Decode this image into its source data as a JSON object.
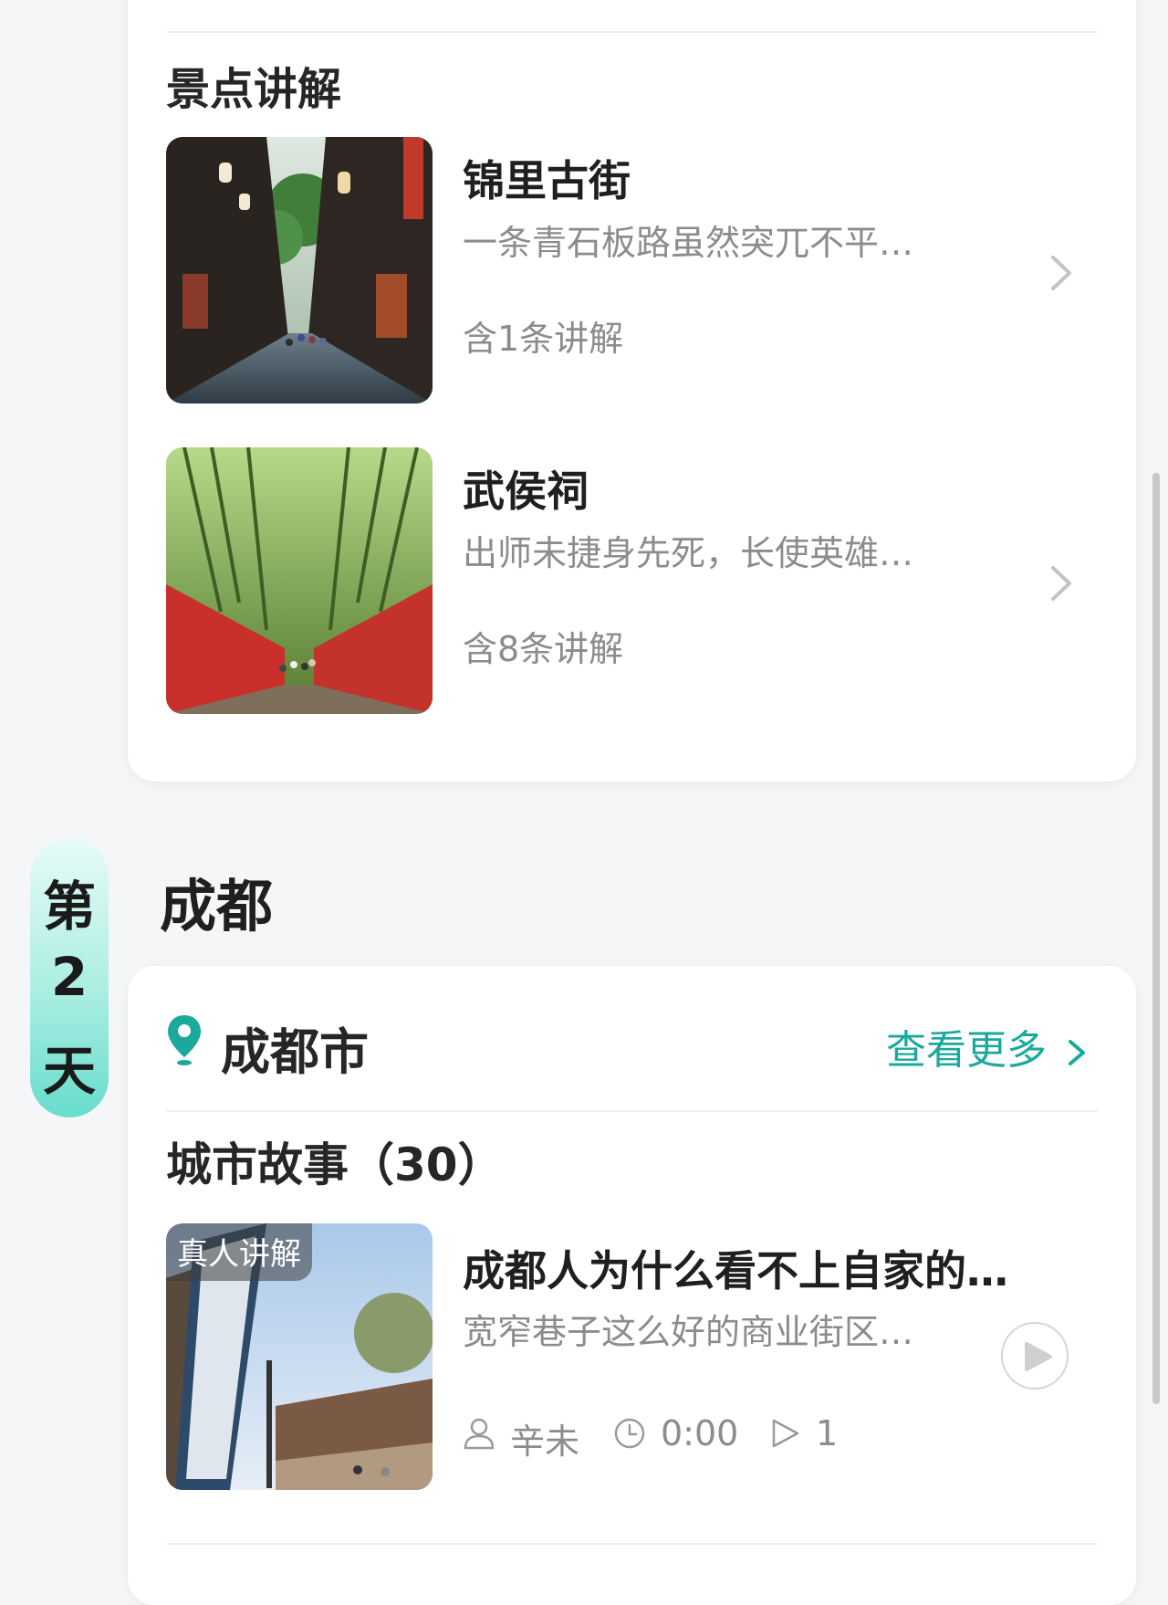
{
  "attractions_card": {
    "section_title": "景点讲解",
    "items": [
      {
        "name": "锦里古街",
        "desc": "一条青石板路虽然突兀不平…",
        "count": "含1条讲解"
      },
      {
        "name": "武侯祠",
        "desc": "出师未捷身先死，长使英雄…",
        "count": "含8条讲解"
      }
    ]
  },
  "day": {
    "chars": [
      "第",
      "2",
      "天"
    ],
    "city": "成都"
  },
  "city_card": {
    "city_name": "成都市",
    "more_label": "查看更多",
    "stories_title": "城市故事（30）",
    "story": {
      "badge": "真人讲解",
      "title": "成都人为什么看不上自家的…",
      "desc": "宽窄巷子这么好的商业街区…",
      "author": "辛未",
      "duration": "0:00",
      "plays": "1"
    }
  },
  "colors": {
    "accent": "#1aa99c",
    "day_tag": "#68ddcc"
  },
  "icons": {
    "chevron": "chevron-right-icon",
    "pin": "location-pin-icon",
    "user": "user-icon",
    "clock": "clock-icon",
    "play_count": "play-outline-icon",
    "play": "play-icon"
  }
}
